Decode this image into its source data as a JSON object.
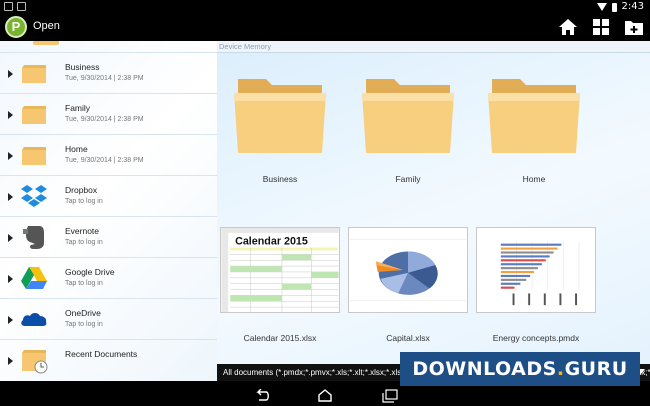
{
  "status": {
    "time": "2:43"
  },
  "actionbar": {
    "logo_letter": "P",
    "title": "Open"
  },
  "sidebar": {
    "items": [
      {
        "name": "Business",
        "sub": "Tue, 9/30/2014 | 2:38 PM",
        "icon": "folder-icon"
      },
      {
        "name": "Family",
        "sub": "Tue, 9/30/2014 | 2:38 PM",
        "icon": "folder-icon"
      },
      {
        "name": "Home",
        "sub": "Tue, 9/30/2014 | 2:38 PM",
        "icon": "folder-icon"
      },
      {
        "name": "Dropbox",
        "sub": "Tap to log in",
        "icon": "dropbox-icon"
      },
      {
        "name": "Evernote",
        "sub": "Tap to log in",
        "icon": "evernote-icon"
      },
      {
        "name": "Google Drive",
        "sub": "Tap to log in",
        "icon": "google-drive-icon"
      },
      {
        "name": "OneDrive",
        "sub": "Tap to log in",
        "icon": "onedrive-icon"
      },
      {
        "name": "Recent Documents",
        "sub": "",
        "icon": "recent-documents-icon"
      }
    ]
  },
  "main": {
    "location": "Device Memory",
    "tiles": [
      {
        "label": "Business",
        "kind": "folder"
      },
      {
        "label": "Family",
        "kind": "folder"
      },
      {
        "label": "Home",
        "kind": "folder"
      },
      {
        "label": "Calendar 2015.xlsx",
        "kind": "spreadsheet",
        "thumb_title": "Calendar 2015"
      },
      {
        "label": "Capital.xlsx",
        "kind": "pie-chart"
      },
      {
        "label": "Energy concepts.pmdx",
        "kind": "bar-chart"
      }
    ]
  },
  "filter": {
    "text": "All documents (*.pmdx;*.pmvx;*.xls;*.xlt;*.xlsx;*.xlsm;*.xltx;*.xltm;*.pmd;*.pmv;*.prd;*.prv;*.prdx;*.prvx;*.tmd;*.tmv;*.tmdx;*.tmvx;*.doc;*.dot;*.docx;*.docm;*.dotx;*.dotm;*.rtf;*.odt;*.ott;*.sxw;*.stw;*.csv;*.dif;*.slk;*.sdc;*.ods;*.ots;*.htm;*.html;*.txt)"
  },
  "watermark": {
    "text_a": "DOWNLOADS",
    "dot": ".",
    "text_b": "GURU"
  },
  "colors": {
    "accent": "#7ab32e",
    "folder": "#f6c770",
    "dropbox": "#1f8ce0",
    "watermark_bg": "#1e4e86"
  }
}
